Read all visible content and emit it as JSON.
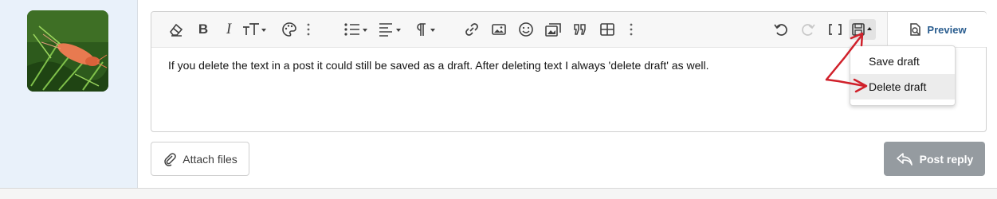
{
  "editor": {
    "content": "If you delete the text in a post it could still be saved as a draft. After deleting text I always 'delete draft' as well."
  },
  "toolbar": {
    "icons": [
      "eraser-icon",
      "bold-icon",
      "italic-icon",
      "font-size-icon",
      "palette-icon",
      "more-icon",
      "list-icon",
      "align-icon",
      "paragraph-icon",
      "link-icon",
      "image-icon",
      "smiley-icon",
      "media-icon",
      "quote-icon",
      "table-icon",
      "more-icon",
      "undo-icon",
      "redo-icon",
      "bbcode-icon",
      "drafts-icon"
    ],
    "bold_label": "B",
    "italic_label": "I",
    "preview_label": "Preview"
  },
  "drafts_menu": {
    "items": [
      {
        "label": "Save draft",
        "active": false
      },
      {
        "label": "Delete draft",
        "active": true
      }
    ]
  },
  "actions": {
    "attach_label": "Attach files",
    "post_reply_label": "Post reply"
  },
  "colors": {
    "annotation": "#d0202a",
    "post_button": "#959ba0",
    "preview_text": "#2a5d8f",
    "left_pane": "#e9f1fa"
  }
}
